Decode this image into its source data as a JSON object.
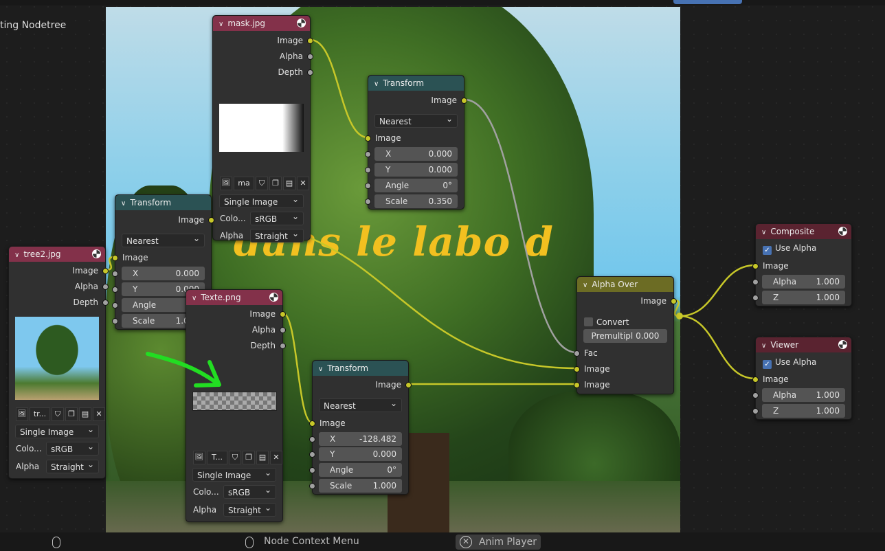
{
  "editor": {
    "tree_label": "ting Nodetree",
    "backdrop_text": "dans le labo d"
  },
  "colors": {
    "input_header": "#83314a",
    "converter_header": "#2b5254",
    "color_header": "#6c6c24",
    "output_header": "#5a2330",
    "image_socket": "#c7c729",
    "value_socket": "#a1a1a1",
    "link": "#c7c729"
  },
  "nodes": {
    "mask": {
      "title": "mask.jpg",
      "header": "input",
      "rows": [
        {
          "type": "out",
          "label": "Image",
          "sock": "y"
        },
        {
          "type": "out",
          "label": "Alpha",
          "sock": "g"
        },
        {
          "type": "out",
          "label": "Depth",
          "sock": "g"
        },
        {
          "type": "preview",
          "kind": "white-gradient"
        },
        {
          "type": "selector",
          "value": "ma"
        },
        {
          "type": "dd",
          "value": "Single Image"
        },
        {
          "type": "ldd",
          "label": "Colo...",
          "value": "sRGB"
        },
        {
          "type": "ldd",
          "label": "Alpha",
          "value": "Straight"
        }
      ]
    },
    "transform_top": {
      "title": "Transform",
      "header": "converter",
      "rows": [
        {
          "type": "out",
          "label": "Image",
          "sock": "y"
        },
        {
          "type": "dd",
          "value": "Nearest"
        },
        {
          "type": "in",
          "label": "Image",
          "sock": "y"
        },
        {
          "type": "field",
          "label": "X",
          "value": "0.000"
        },
        {
          "type": "field",
          "label": "Y",
          "value": "0.000"
        },
        {
          "type": "field",
          "label": "Angle",
          "value": "0°"
        },
        {
          "type": "field",
          "label": "Scale",
          "value": "0.350"
        }
      ]
    },
    "transform_left": {
      "title": "Transform",
      "header": "converter",
      "rows": [
        {
          "type": "out",
          "label": "Image",
          "sock": "y"
        },
        {
          "type": "dd",
          "value": "Nearest"
        },
        {
          "type": "in",
          "label": "Image",
          "sock": "y"
        },
        {
          "type": "field",
          "label": "X",
          "value": "0.000"
        },
        {
          "type": "field",
          "label": "Y",
          "value": "0.000"
        },
        {
          "type": "field",
          "label": "Angle",
          "value": "0°"
        },
        {
          "type": "field",
          "label": "Scale",
          "value": "1.000"
        }
      ]
    },
    "tree2": {
      "title": "tree2.jpg",
      "header": "input",
      "rows": [
        {
          "type": "out",
          "label": "Image",
          "sock": "y"
        },
        {
          "type": "out",
          "label": "Alpha",
          "sock": "g"
        },
        {
          "type": "out",
          "label": "Depth",
          "sock": "g"
        },
        {
          "type": "preview",
          "kind": "tree"
        },
        {
          "type": "selector",
          "value": "tr..."
        },
        {
          "type": "dd",
          "value": "Single Image"
        },
        {
          "type": "ldd",
          "label": "Colo...",
          "value": "sRGB"
        },
        {
          "type": "ldd",
          "label": "Alpha",
          "value": "Straight"
        }
      ]
    },
    "texte": {
      "title": "Texte.png",
      "header": "input",
      "rows": [
        {
          "type": "out",
          "label": "Image",
          "sock": "y"
        },
        {
          "type": "out",
          "label": "Alpha",
          "sock": "g"
        },
        {
          "type": "out",
          "label": "Depth",
          "sock": "g"
        },
        {
          "type": "preview",
          "kind": "checker"
        },
        {
          "type": "selector",
          "value": "T..."
        },
        {
          "type": "dd",
          "value": "Single Image"
        },
        {
          "type": "ldd",
          "label": "Colo...",
          "value": "sRGB"
        },
        {
          "type": "ldd",
          "label": "Alpha",
          "value": "Straight"
        }
      ]
    },
    "transform_bottom": {
      "title": "Transform",
      "header": "converter",
      "rows": [
        {
          "type": "out",
          "label": "Image",
          "sock": "y"
        },
        {
          "type": "dd",
          "value": "Nearest"
        },
        {
          "type": "in",
          "label": "Image",
          "sock": "y"
        },
        {
          "type": "field",
          "label": "X",
          "value": "-128.482"
        },
        {
          "type": "field",
          "label": "Y",
          "value": "0.000"
        },
        {
          "type": "field",
          "label": "Angle",
          "value": "0°"
        },
        {
          "type": "field",
          "label": "Scale",
          "value": "1.000"
        }
      ]
    },
    "alpha_over": {
      "title": "Alpha Over",
      "header": "color",
      "rows": [
        {
          "type": "out",
          "label": "Image",
          "sock": "y"
        },
        {
          "type": "chk",
          "label": "Convert Premulti...",
          "checked": false
        },
        {
          "type": "btnfield",
          "label": "Premultipl",
          "value": "0.000"
        },
        {
          "type": "in",
          "label": "Fac",
          "sock": "g"
        },
        {
          "type": "in",
          "label": "Image",
          "sock": "y"
        },
        {
          "type": "in",
          "label": "Image",
          "sock": "y"
        }
      ]
    },
    "composite": {
      "title": "Composite",
      "header": "output",
      "rows": [
        {
          "type": "chk",
          "label": "Use Alpha",
          "checked": true
        },
        {
          "type": "in",
          "label": "Image",
          "sock": "y"
        },
        {
          "type": "field",
          "label": "Alpha",
          "value": "1.000"
        },
        {
          "type": "field",
          "label": "Z",
          "value": "1.000"
        }
      ]
    },
    "viewer": {
      "title": "Viewer",
      "header": "output",
      "rows": [
        {
          "type": "chk",
          "label": "Use Alpha",
          "checked": true
        },
        {
          "type": "in",
          "label": "Image",
          "sock": "y"
        },
        {
          "type": "field",
          "label": "Alpha",
          "value": "1.000"
        },
        {
          "type": "field",
          "label": "Z",
          "value": "1.000"
        }
      ]
    }
  },
  "status_bar": {
    "context_menu": "Node Context Menu",
    "anim_player": "Anim Player",
    "mouse_icon": "mouse-icon",
    "close_icon": "x-circle-icon"
  }
}
